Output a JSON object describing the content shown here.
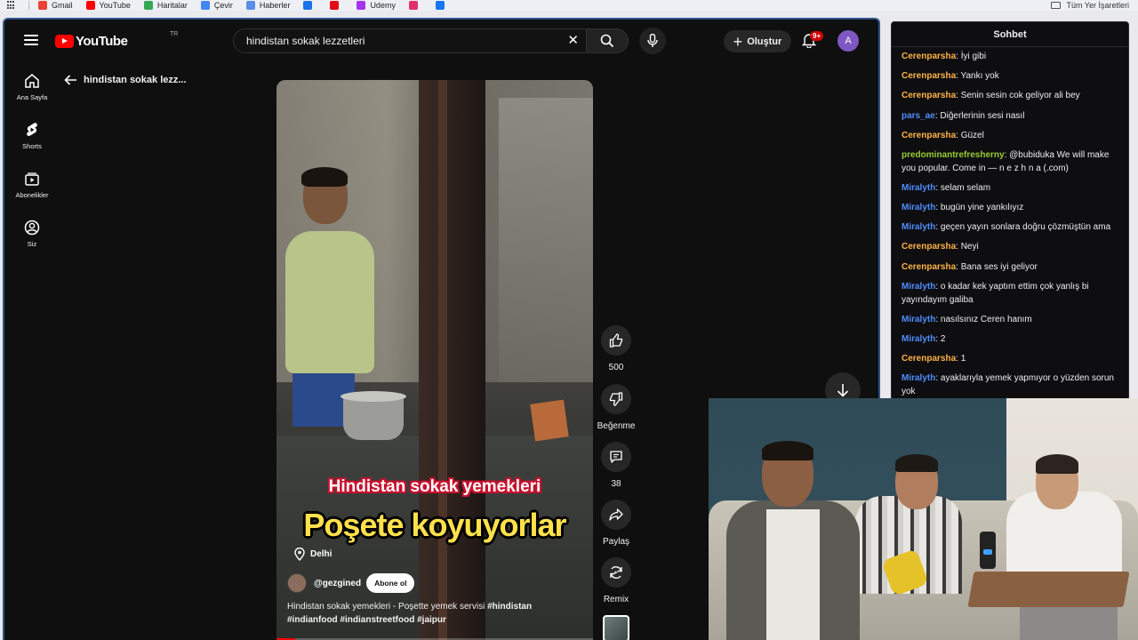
{
  "bookmarks": {
    "items": [
      {
        "label": "Gmail",
        "color": "#ea4335"
      },
      {
        "label": "YouTube",
        "color": "#ff0000"
      },
      {
        "label": "Haritalar",
        "color": "#34a853"
      },
      {
        "label": "Çevir",
        "color": "#4285f4"
      },
      {
        "label": "Haberler",
        "color": "#5a8ee6"
      },
      {
        "label": "",
        "color": "#1a73e8"
      },
      {
        "label": "",
        "color": "#e50914"
      },
      {
        "label": "Udemy",
        "color": "#a435f0"
      },
      {
        "label": "",
        "color": "#e1306c"
      },
      {
        "label": "",
        "color": "#1877f2"
      }
    ],
    "all_bookmarks": "Tüm Yer İşaretleri"
  },
  "youtube": {
    "logo_text": "YouTube",
    "logo_region": "TR",
    "search_value": "hindistan sokak lezzetleri",
    "create_label": "Oluştur",
    "notif_badge": "9+",
    "avatar_letter": "A",
    "avatar_color": "#7e57c2"
  },
  "sidebar": {
    "items": [
      {
        "label": "Ana Sayfa",
        "icon": "home-icon"
      },
      {
        "label": "Shorts",
        "icon": "shorts-icon"
      },
      {
        "label": "Abonelikler",
        "icon": "subscriptions-icon"
      },
      {
        "label": "Siz",
        "icon": "account-icon"
      }
    ]
  },
  "breadcrumb": {
    "back_label": "hindistan sokak lezz..."
  },
  "short": {
    "caption_top": "Hindistan sokak yemekleri",
    "caption_main": "Poşete koyuyorlar",
    "location": "Delhi",
    "channel": "@gezgined",
    "subscribe_label": "Abone ol",
    "description_plain": "Hindistan sokak yemekleri - Poşette yemek servisi ",
    "description_tags_1": "#hindistan",
    "description_tags_2": "#indianfood #indianstreetfood #jaipur",
    "progress": 0.06
  },
  "actions": {
    "likes": "500",
    "dislike_label": "Beğenme",
    "comments": "38",
    "share_label": "Paylaş",
    "remix_label": "Remix"
  },
  "chat": {
    "title": "Sohbet",
    "messages": [
      {
        "user": "Cerenparsha",
        "color": "#ffb347",
        "text": "İyi gibi"
      },
      {
        "user": "Cerenparsha",
        "color": "#ffb347",
        "text": "Yankı yok"
      },
      {
        "user": "Cerenparsha",
        "color": "#ffb347",
        "text": "Senin sesin cok geliyor ali bey"
      },
      {
        "user": "pars_ae",
        "color": "#4f8dff",
        "text": "Diğerlerinin sesi nasıl"
      },
      {
        "user": "Cerenparsha",
        "color": "#ffb347",
        "text": "Güzel"
      },
      {
        "user": "predominantrefresherny",
        "color": "#9acd32",
        "text": "@bubiduka We will make you popular. Come in —  n e z h n a (.com)"
      },
      {
        "user": "Miralyth",
        "color": "#4f8dff",
        "text": "selam selam"
      },
      {
        "user": "Miralyth",
        "color": "#4f8dff",
        "text": "bugün yine yankılıyız"
      },
      {
        "user": "Miralyth",
        "color": "#4f8dff",
        "text": "geçen yayın sonlara doğru çözmüştün ama"
      },
      {
        "user": "Cerenparsha",
        "color": "#ffb347",
        "text": "Neyi"
      },
      {
        "user": "Cerenparsha",
        "color": "#ffb347",
        "text": "Bana ses iyi geliyor"
      },
      {
        "user": "Miralyth",
        "color": "#4f8dff",
        "text": "o kadar kek yaptım ettim çok yanlış bi yayındayım galiba"
      },
      {
        "user": "Miralyth",
        "color": "#4f8dff",
        "text": "nasılsınız Ceren hanım"
      },
      {
        "user": "Miralyth",
        "color": "#4f8dff",
        "text": "2"
      },
      {
        "user": "Cerenparsha",
        "color": "#ffb347",
        "text": "1"
      },
      {
        "user": "Miralyth",
        "color": "#4f8dff",
        "text": "ayaklarıyla yemek yapmıyor o yüzden sorun yok"
      }
    ]
  }
}
